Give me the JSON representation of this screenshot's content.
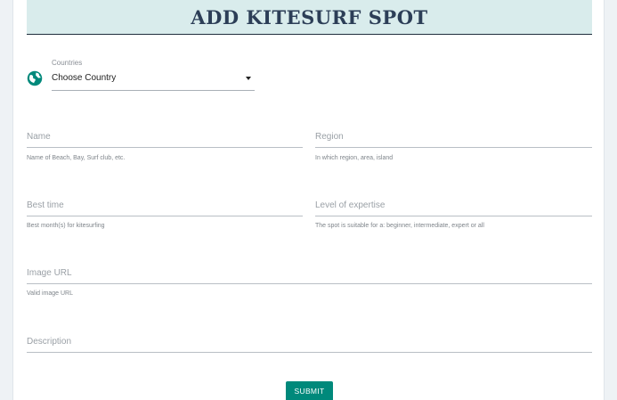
{
  "header": {
    "title": "ADD KITESURF SPOT"
  },
  "country_select": {
    "label": "Countries",
    "value": "Choose Country",
    "icon": "globe-icon"
  },
  "fields": {
    "name": {
      "placeholder": "Name",
      "helper": "Name of Beach, Bay, Surf club, etc."
    },
    "region": {
      "placeholder": "Region",
      "helper": "In which region, area, island"
    },
    "best_time": {
      "placeholder": "Best time",
      "helper": "Best month(s) for kitesurfing"
    },
    "level": {
      "placeholder": "Level of expertise",
      "helper": "The spot is suitable for a: beginner, intermediate, expert or all"
    },
    "image_url": {
      "placeholder": "Image URL",
      "helper": "Valid image URL"
    },
    "description": {
      "placeholder": "Description"
    }
  },
  "submit": {
    "label": "SUBMIT"
  },
  "colors": {
    "header_bg": "#d9ecec",
    "accent": "#00897b",
    "title": "#2c3e57"
  }
}
